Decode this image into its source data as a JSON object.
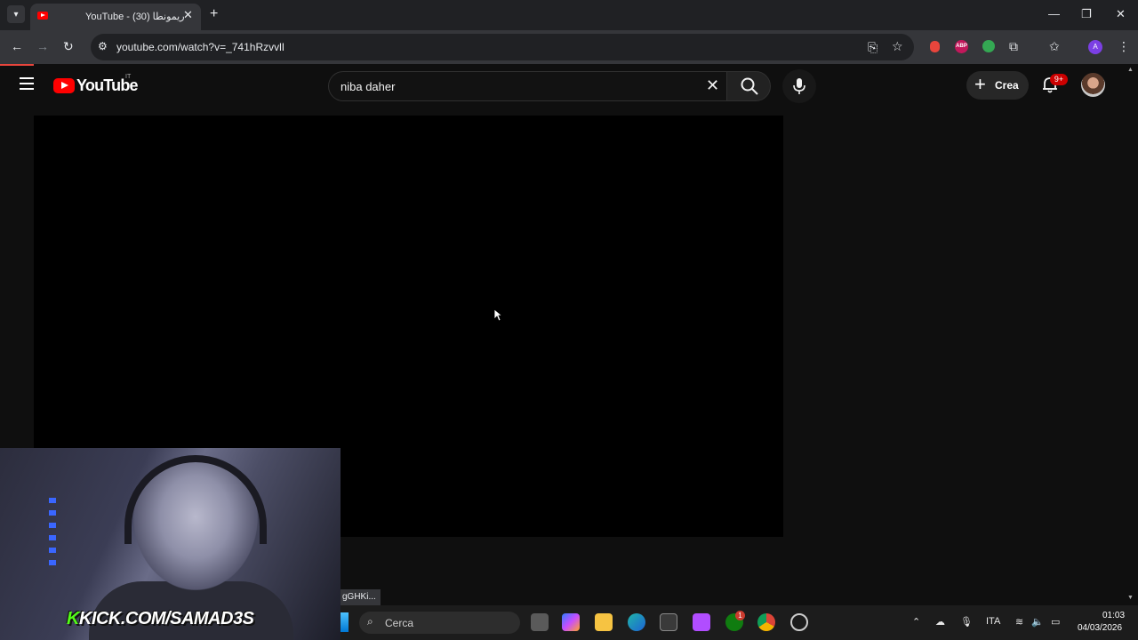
{
  "browser": {
    "tab_title": "YouTube - ريمونطا (30)",
    "url": "youtube.com/watch?v=_741hRzvvlI",
    "status_url": "gGHKi..."
  },
  "youtube": {
    "wordmark": "YouTube",
    "country": "IT",
    "search_value": "niba daher",
    "create_label": "Crea",
    "notif_badge": "9+"
  },
  "webcam": {
    "overlay_text_k": "K",
    "overlay_text_rest": "KICK.COM/SAMAD3S"
  },
  "taskbar": {
    "search_placeholder": "Cerca",
    "language": "ITA",
    "time": "01:03",
    "date": "04/03/2026",
    "xbox_badge": "1"
  },
  "icons": {
    "tab_search": "chevron-down-icon",
    "back": "arrow-left-icon",
    "forward": "arrow-right-icon",
    "reload": "reload-icon",
    "mic": "microphone-icon",
    "bell": "bell-icon"
  },
  "colors": {
    "yt_red": "#ff0000",
    "kick_green": "#53fc18",
    "badge_red": "#cc0000"
  }
}
